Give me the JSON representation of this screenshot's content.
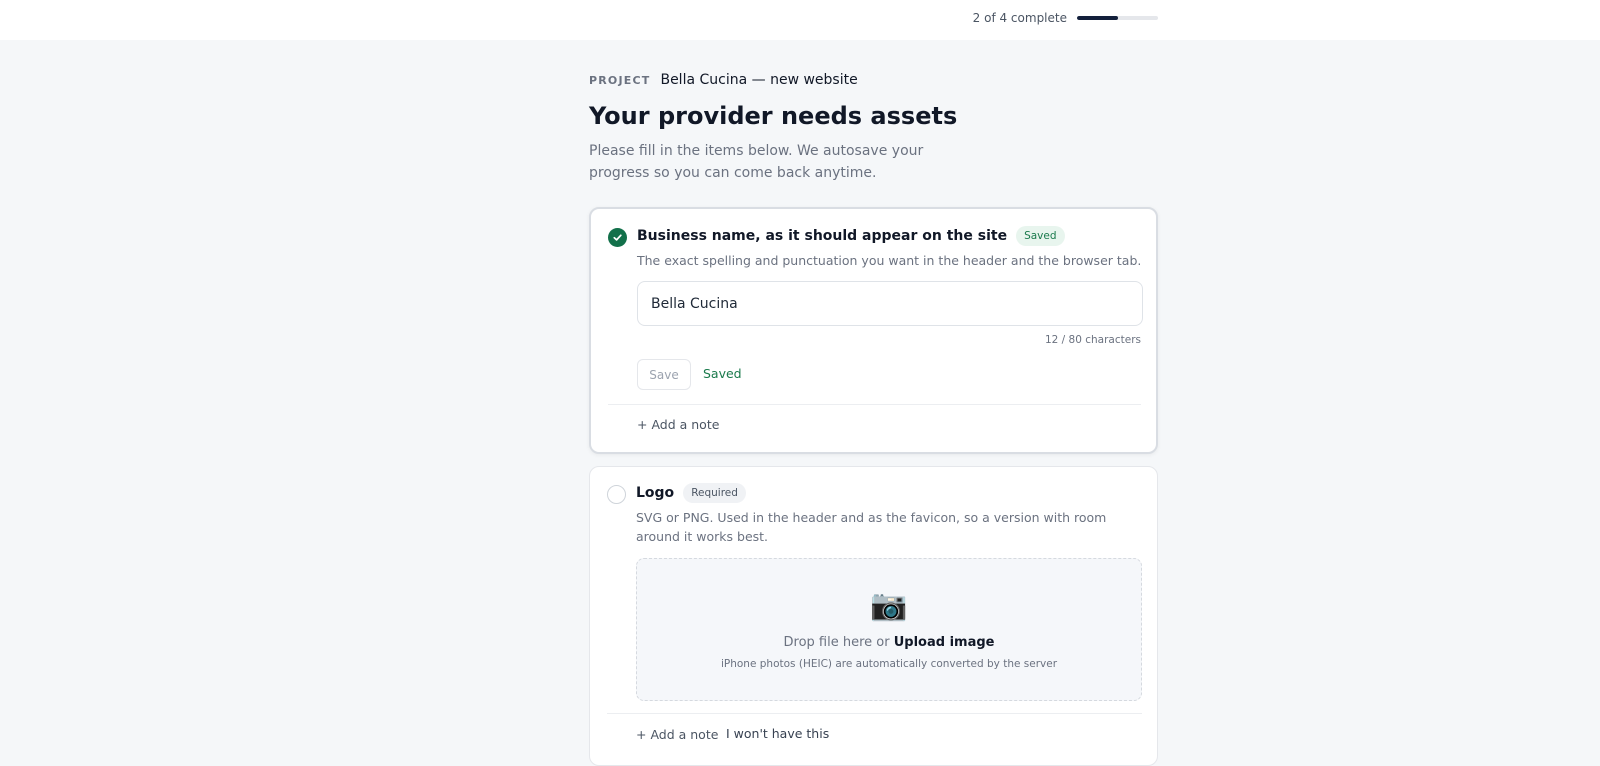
{
  "header": {
    "progress_text": "2 of 4 complete",
    "progress_fraction": 0.5
  },
  "project": {
    "label": "PROJECT",
    "name": "Bella Cucina — new website"
  },
  "page": {
    "title": "Your provider needs assets",
    "intro": "Please fill in the items below. We autosave your progress so you can come back anytime."
  },
  "items": [
    {
      "title": "Business name, as it should appear on the site",
      "badge": "Saved",
      "description": "The exact spelling and punctuation you want in the header and the browser tab.",
      "input_value": "Bella Cucina",
      "char_count": "12 / 80 characters",
      "save_label": "Save",
      "saved_label": "Saved",
      "add_note_label": "+  Add a note"
    },
    {
      "title": "Logo",
      "badge": "Required",
      "description": "SVG or PNG. Used in the header and as the favicon, so a version with room around it works best.",
      "dropzone_icon": "📷",
      "drop_text": "Drop file here or ",
      "upload_label": "Upload image",
      "drop_hint": "iPhone photos (HEIC) are automatically converted by the server",
      "add_note_label": "+  Add a note",
      "wont_have_label": "I won't have this"
    }
  ],
  "colors": {
    "accent": "#13203b",
    "success": "#12704a",
    "background": "#f5f7f9"
  }
}
